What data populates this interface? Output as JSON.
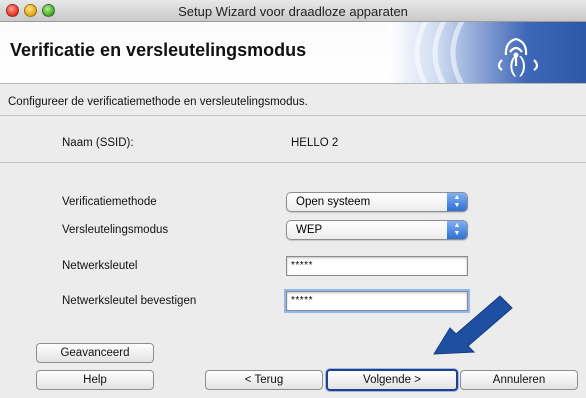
{
  "window": {
    "title": "Setup Wizard voor draadloze apparaten"
  },
  "header": {
    "page_title": "Verificatie en versleutelingsmodus"
  },
  "intro": "Configureer de verificatiemethode en versleutelingsmodus.",
  "ssid": {
    "label": "Naam (SSID):",
    "value": "HELLO 2"
  },
  "auth": {
    "label": "Verificatiemethode",
    "selected": "Open systeem"
  },
  "encryption": {
    "label": "Versleutelingsmodus",
    "selected": "WEP"
  },
  "key": {
    "label": "Netwerksleutel",
    "value": "*****"
  },
  "key_confirm": {
    "label": "Netwerksleutel bevestigen",
    "value": "*****"
  },
  "buttons": {
    "advanced": "Geavanceerd",
    "help": "Help",
    "back": "< Terug",
    "next": "Volgende >",
    "cancel": "Annuleren"
  },
  "colors": {
    "accent_blue": "#2f57a7",
    "arrow_blue": "#1f4fa0"
  },
  "icons": {
    "logo": "wireless-signal-icon",
    "pointer": "pointing-arrow-icon"
  }
}
